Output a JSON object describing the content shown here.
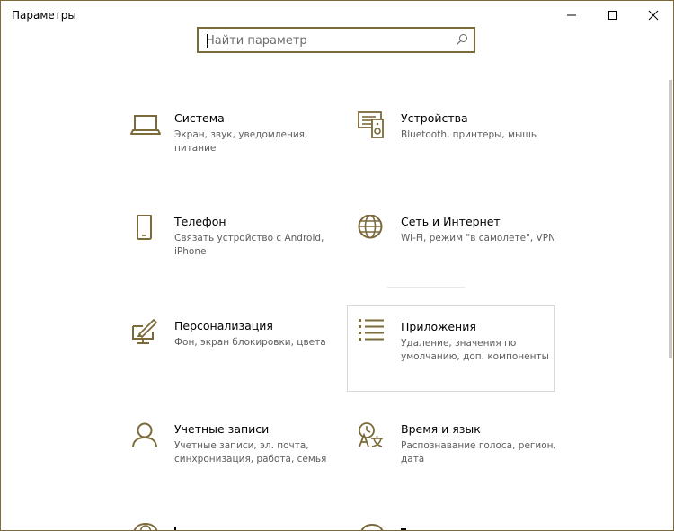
{
  "window": {
    "title": "Параметры",
    "minimize": "minimize-icon",
    "maximize": "maximize-icon",
    "close": "close-icon"
  },
  "search": {
    "placeholder": "Найти параметр",
    "icon": "search-icon"
  },
  "accent_color": "#7b6a3a",
  "categories": [
    {
      "name": "Система",
      "desc": "Экран, звук, уведомления, питание",
      "icon": "laptop-icon"
    },
    {
      "name": "Устройства",
      "desc": "Bluetooth, принтеры, мышь",
      "icon": "devices-icon"
    },
    {
      "name": "Телефон",
      "desc": "Связать устройство с Android, iPhone",
      "icon": "phone-icon"
    },
    {
      "name": "Сеть и Интернет",
      "desc": "Wi-Fi, режим \"в самолете\", VPN",
      "icon": "globe-icon"
    },
    {
      "name": "Персонализация",
      "desc": "Фон, экран блокировки, цвета",
      "icon": "personalization-icon"
    },
    {
      "name": "Приложения",
      "desc": "Удаление, значения по умолчанию, доп. компоненты",
      "icon": "apps-list-icon",
      "selected": true
    },
    {
      "name": "Учетные записи",
      "desc": "Учетные записи, эл. почта, синхронизация, работа, семья",
      "icon": "person-icon"
    },
    {
      "name": "Время и язык",
      "desc": "Распознавание голоса, регион, дата",
      "icon": "time-language-icon"
    }
  ]
}
